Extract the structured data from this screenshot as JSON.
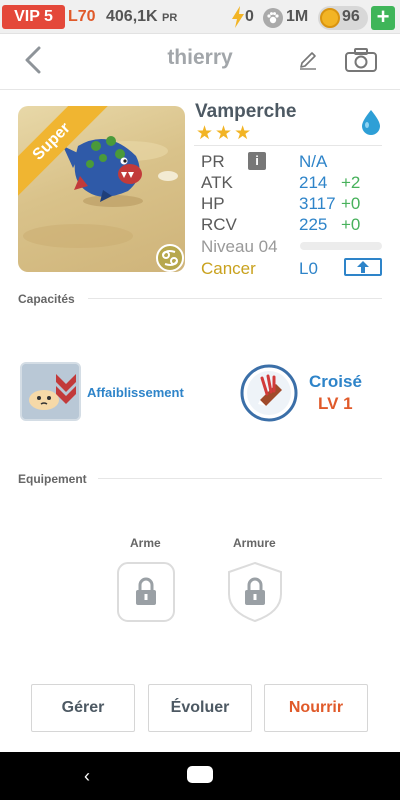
{
  "status": {
    "vip": "VIP 5",
    "level": "L70",
    "power": "406,1K",
    "power_unit": "PR",
    "energy": "0",
    "food": "1M",
    "coins": "96",
    "add_label": "+"
  },
  "header": {
    "title": "thierry",
    "icons": [
      "back-arrow-icon",
      "pencil-icon",
      "camera-icon"
    ]
  },
  "monster": {
    "name": "Vamperche",
    "stars": "★★★",
    "ribbon": "Super",
    "element": "water",
    "stats": [
      {
        "label": "PR",
        "value": "N/A",
        "bonus": ""
      },
      {
        "label": "ATK",
        "value": "214",
        "bonus": "+2"
      },
      {
        "label": "HP",
        "value": "3117",
        "bonus": "+0"
      },
      {
        "label": "RCV",
        "value": "225",
        "bonus": "+0"
      }
    ],
    "level_label": "Niveau 04",
    "level_progress": 0,
    "sign_label": "Cancer",
    "sign_level": "L0",
    "info_label": "i"
  },
  "sections": {
    "abilities": "Capacités",
    "equipment": "Equipement"
  },
  "abilities": {
    "skill_name": "Affaiblissement",
    "leader_name": "Croisé",
    "leader_level": "LV 1"
  },
  "equipment": {
    "weapon_label": "Arme",
    "armor_label": "Armure"
  },
  "actions": {
    "manage": "Gérer",
    "evolve": "Évoluer",
    "feed": "Nourrir"
  },
  "colors": {
    "accent_blue": "#2e84c9",
    "accent_orange": "#e05a2a",
    "bonus_green": "#47b15b",
    "sign_gold": "#c9a21e"
  }
}
